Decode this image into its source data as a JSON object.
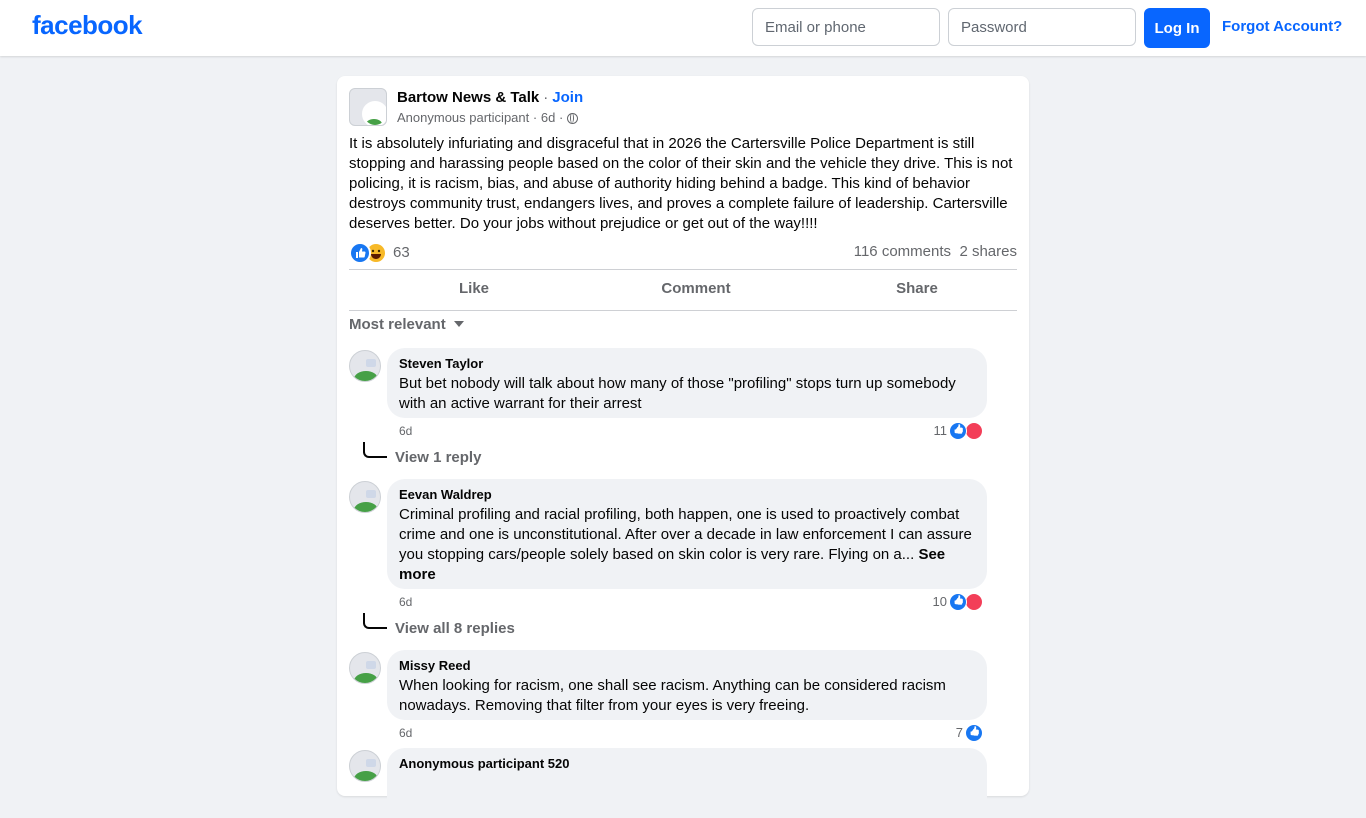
{
  "header": {
    "logo": "facebook",
    "email_placeholder": "Email or phone",
    "password_placeholder": "Password",
    "login_label": "Log In",
    "forgot_label": "Forgot Account?"
  },
  "post": {
    "group_name": "Bartow News & Talk",
    "separator": "·",
    "join_label": "Join",
    "author": "Anonymous participant",
    "time": "6d",
    "text": "It is absolutely infuriating and disgraceful that in 2026 the Cartersville Police Department is still stopping and harassing people based on the color of their skin and the vehicle they drive. This is not policing, it is racism, bias, and abuse of authority hiding behind a badge. This kind of behavior destroys community trust, endangers lives, and proves a complete failure of leadership. Cartersville deserves better. Do your jobs without prejudice or get out of the way!!!!",
    "reaction_count": "63",
    "comments_count": "116 comments",
    "shares_count": "2 shares",
    "actions": {
      "like": "Like",
      "comment": "Comment",
      "share": "Share"
    },
    "sort_label": "Most relevant"
  },
  "comments": [
    {
      "name": "Steven Taylor",
      "text": "But bet nobody will talk about how many of those \"profiling\" stops turn up somebody with an active warrant for their arrest",
      "time": "6d",
      "reactions": "11",
      "reply_link": "View 1 reply"
    },
    {
      "name": "Eevan Waldrep",
      "text": "Criminal profiling and racial profiling, both happen, one is used to proactively combat crime and one is unconstitutional. After over a decade in law enforcement I can assure you stopping cars/people solely based on skin color is very rare. Flying on a... ",
      "see_more": "See more",
      "time": "6d",
      "reactions": "10",
      "reply_link": "View all 8 replies"
    },
    {
      "name": "Missy Reed",
      "text": "When looking for racism, one shall see racism. Anything can be considered racism nowadays. Removing that filter from your eyes is very freeing.",
      "time": "6d",
      "reactions": "7"
    },
    {
      "name": "Anonymous participant 520"
    }
  ],
  "colors": {
    "brand": "#0866ff",
    "like": "#1877f2",
    "love": "#f33e58",
    "haha": "#f7b928"
  }
}
